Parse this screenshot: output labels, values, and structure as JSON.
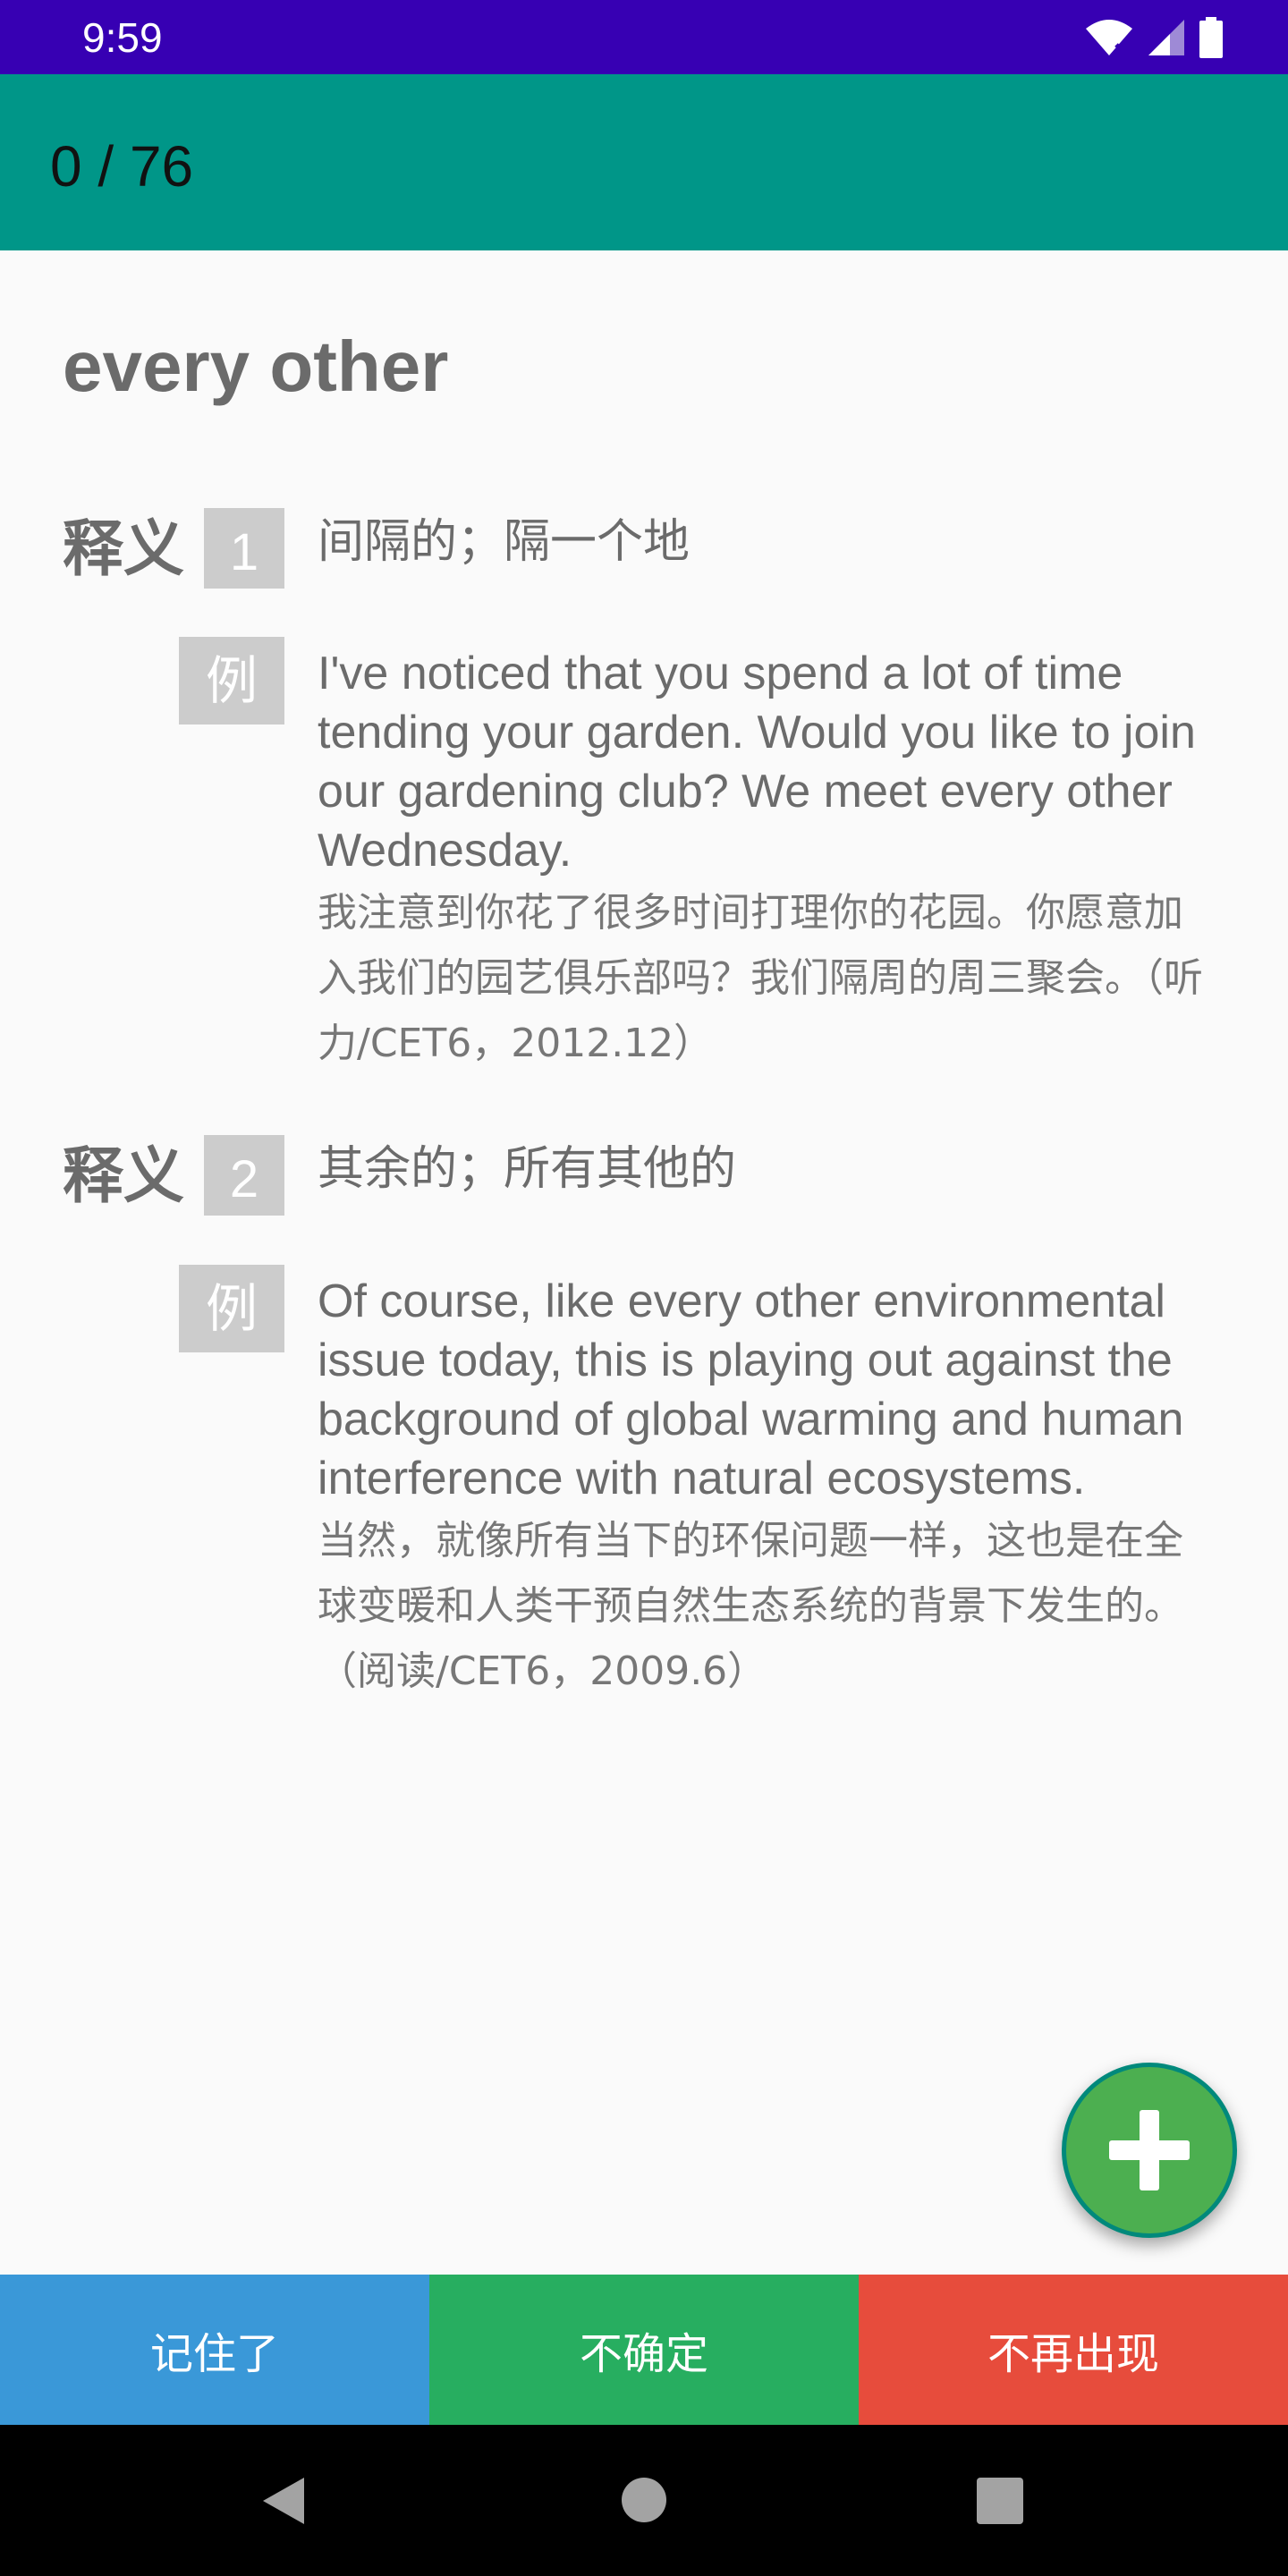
{
  "status_bar": {
    "time": "9:59",
    "icons": [
      "wifi-icon",
      "cellular-signal-icon",
      "battery-icon"
    ],
    "background_color": "#3700b3"
  },
  "toolbar": {
    "progress": "0 / 76",
    "background_color": "#009688"
  },
  "word": {
    "title": "every other"
  },
  "definitions": [
    {
      "label": "释义",
      "number": "1",
      "meaning": "间隔的；隔一个地",
      "example_badge": "例",
      "example_en": "I've noticed that you spend a lot of time tending your garden. Would you like to join our gardening club? We meet every other Wednesday.",
      "example_zh": "我注意到你花了很多时间打理你的花园。你愿意加入我们的园艺俱乐部吗？我们隔周的周三聚会。（听力/CET6，2012.12）"
    },
    {
      "label": "释义",
      "number": "2",
      "meaning": "其余的；所有其他的",
      "example_badge": "例",
      "example_en": "Of course, like every other environmental issue today, this is playing out against the background of global warming and human interference with natural ecosystems.",
      "example_zh": "当然，就像所有当下的环保问题一样，这也是在全球变暖和人类干预自然生态系统的背景下发生的。（阅读/CET6，2009.6）"
    }
  ],
  "fab": {
    "icon": "add-icon",
    "color": "#4caf50"
  },
  "actions": {
    "remember_label": "记住了",
    "unsure_label": "不确定",
    "never_label": "不再出现",
    "remember_color": "#3a98d8",
    "unsure_color": "#27ae60",
    "never_color": "#e74c3c"
  },
  "nav_bar": {
    "icons": [
      "back-icon",
      "home-icon",
      "recents-icon"
    ]
  }
}
